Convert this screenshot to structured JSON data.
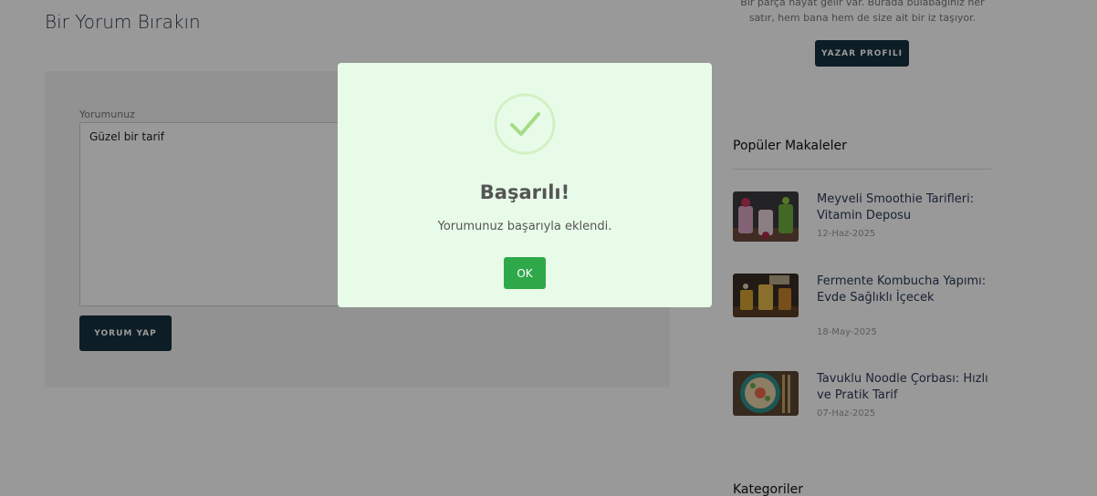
{
  "comment_form": {
    "title": "Bir Yorum Bırakın",
    "label": "Yorumunuz",
    "value": "Güzel bir tarif",
    "submit_label": "YORUM YAP"
  },
  "sidebar": {
    "author_bio_lines": [
      "Bir parça hayat gelir var. Burada bulabağınız her",
      "satır, hem bana hem de size ait bir iz taşıyor."
    ],
    "author_button": "YAZAR PROFILI",
    "popular_heading": "Popüler Makaleler",
    "posts": [
      {
        "title": "Meyveli Smoothie Tarifleri: Vitamin Deposu",
        "date": "12-Haz-2025"
      },
      {
        "title": "Fermente Kombucha Yapımı: Evde Sağlıklı İçecek",
        "date": "18-May-2025"
      },
      {
        "title": "Tavuklu Noodle Çorbası: Hızlı ve Pratik Tarif",
        "date": "07-Haz-2025"
      }
    ],
    "categories_heading": "Kategoriler"
  },
  "modal": {
    "icon": "checkmark-icon",
    "title": "Başarılı!",
    "message": "Yorumunuz başarıyla eklendi.",
    "ok_label": "OK",
    "colors": {
      "background": "#e8fbe8",
      "button": "#2fa84a",
      "icon": "#a5dc86"
    }
  }
}
